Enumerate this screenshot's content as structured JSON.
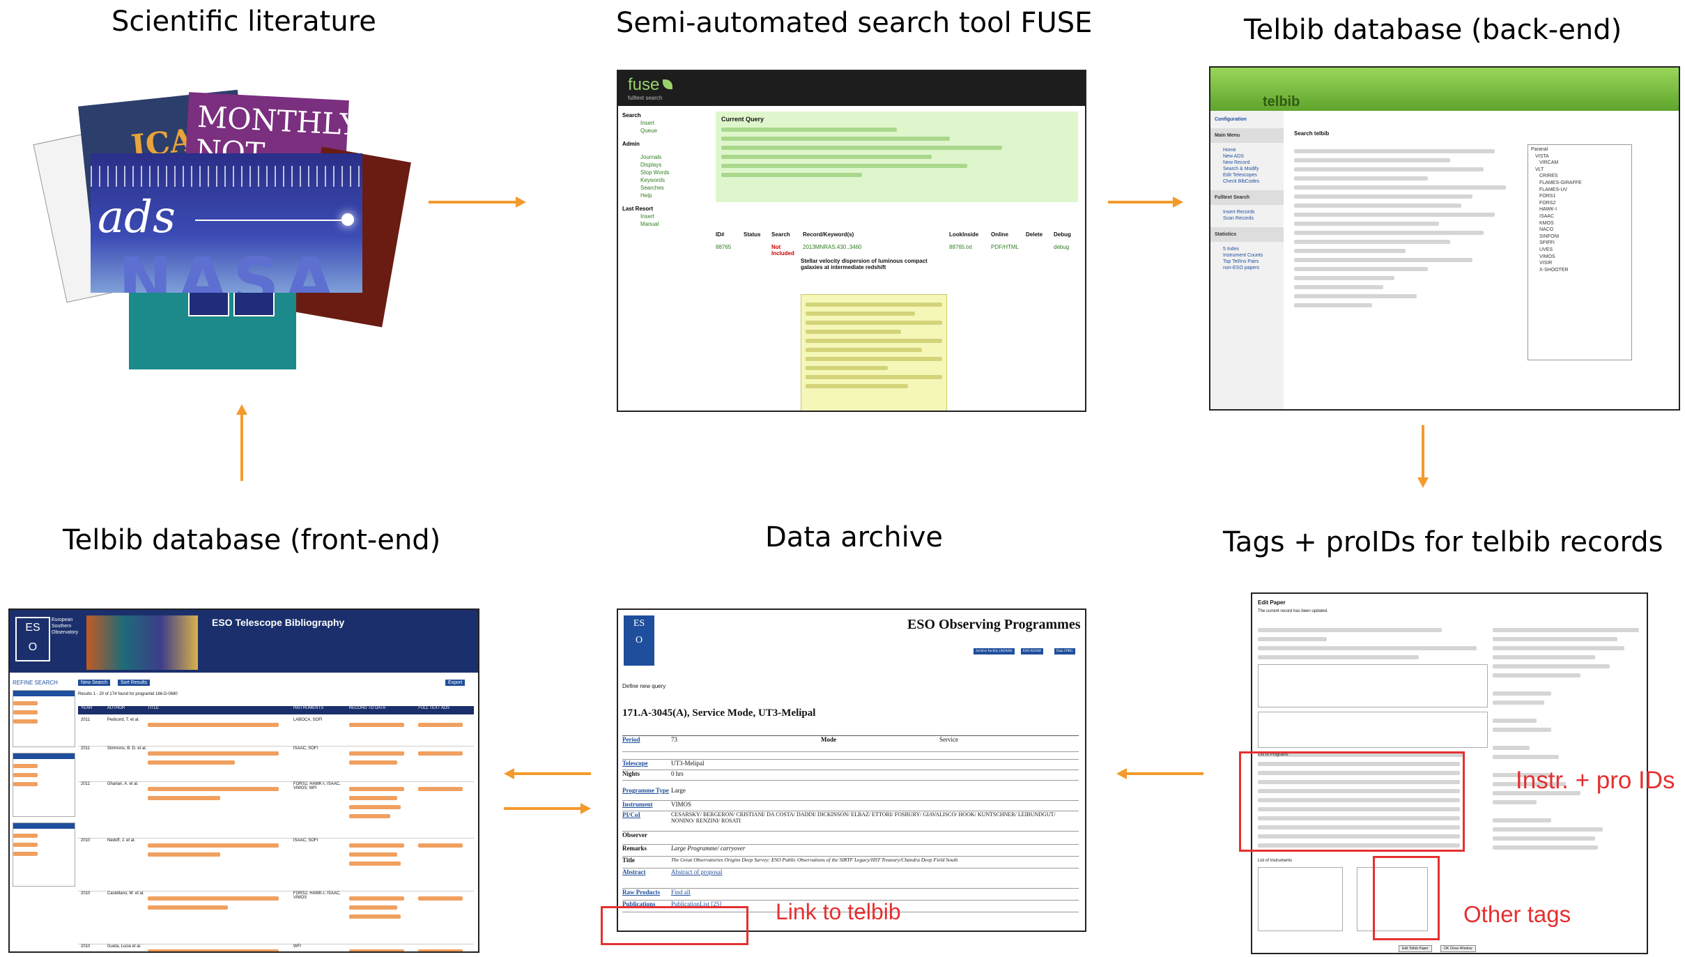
{
  "titles": {
    "literature": "Scientific literature",
    "fuse": "Semi-automated search tool FUSE",
    "backend": "Telbib database (back-end)",
    "frontend": "Telbib database (front-end)",
    "archive": "Data archive",
    "tags": "Tags + proIDs for telbib records"
  },
  "literature": {
    "covers": [
      "ICAR",
      "MONTHLY",
      "NOT",
      "ads",
      "NASA"
    ]
  },
  "fuse": {
    "logo": "fuse",
    "logo_sub": "fulltext search",
    "sidebar": [
      "Search",
      "Insert",
      "Queue",
      "Admin",
      "Journals",
      "Displays",
      "Stop Words",
      "Keywords",
      "Searches",
      "Help",
      "Last Resort",
      "Insert",
      "Manual"
    ],
    "current_query": "Current Query",
    "table_headers": [
      "ID#",
      "Status",
      "Search",
      "Record/Keyword(s)",
      "LookInside",
      "Online",
      "Delete",
      "Debug"
    ],
    "row": [
      "88765",
      "",
      "Not Included",
      "2013MNRAS.430..3460",
      "88765.txt",
      "PDF/HTML",
      "",
      "debug"
    ],
    "record_title": "Stellar velocity dispersion of luminous compact galaxies at intermediate redshift"
  },
  "backend": {
    "logo": "telbib",
    "menu": [
      "Configuration",
      "Main Menu",
      "Home",
      "New ADS",
      "New Record",
      "Search & Modify",
      "Edit Telescopes",
      "Check BibCodes",
      "Fulltext Search",
      "Insert Records",
      "Scan Records",
      "Statistics",
      "5 Index",
      "Instrument Counts",
      "Top Tel/Ins Pairs",
      "non-ESO papers"
    ],
    "heading": "Search telbib",
    "instruments": [
      "Paranal",
      "VISTA",
      "VIRCAM",
      "VLT",
      "CRIRES",
      "FLAMES-GIRAFFE",
      "FLAMES-UV",
      "FORS1",
      "FORS2",
      "HAWK-I",
      "ISAAC",
      "KMOS",
      "NACO",
      "SINFONI",
      "SPIFFI",
      "UVES",
      "VIMOS",
      "VISIR",
      "X-SHOOTER"
    ]
  },
  "frontend": {
    "banner_title": "ESO Telescope Bibliography",
    "eso_text": [
      "European",
      "Southern",
      "Observatory"
    ],
    "refine": "REFINE SEARCH",
    "buttons": [
      "New Search",
      "Sort Results",
      "Export"
    ],
    "results_text": "Results 1 - 20 of 174 found for programid 166-D-0680",
    "columns": [
      "YEAR",
      "AUTHOR",
      "TITLE",
      "INSTRUMENTS",
      "RECORD TO DATA",
      "FULL TEXT ADS"
    ],
    "rows": [
      {
        "year": "2011",
        "author": "Pedicord, T. et al.",
        "inst": "LABOCA, SOFI"
      },
      {
        "year": "2011",
        "author": "Simmons, B. D. et al.",
        "inst": "ISAAC, SOFI"
      },
      {
        "year": "2011",
        "author": "Gharian, A. et al.",
        "inst": "FORS2, HAWK-I, ISAAC, VIMOS, WFI"
      },
      {
        "year": "2010",
        "author": "Nedoff, J. et al.",
        "inst": "ISAAC, SOFI"
      },
      {
        "year": "2010",
        "author": "Castellano, M. et al.",
        "inst": "FORS2, HAWK-I, ISAAC, VIMOS"
      },
      {
        "year": "2010",
        "author": "Gueta, Lucia et al.",
        "inst": "WFI"
      }
    ]
  },
  "archive": {
    "heading": "ESO Observing Programmes",
    "buttons": [
      "Archive Facility (ADAM)",
      "ESO ADAM",
      "Data CPRG"
    ],
    "define": "Define new query",
    "programme": "171.A-3045(A), Service Mode, UT3-Melipal",
    "fields": [
      {
        "label": "Period",
        "value": "73"
      },
      {
        "label": "Telescope",
        "value": "UT3-Melipal"
      },
      {
        "label": "Nights",
        "value": "0 hrs"
      },
      {
        "label": "Programme Type",
        "value": "Large"
      },
      {
        "label": "Instrument",
        "value": "VIMOS"
      },
      {
        "label": "PI/CoI",
        "value": "CESARSKY/ BERGERON/ CRISTIANI/ DA COSTA/ DADDI/ DICKINSON/ ELBAZ/ ETTORI/ FOSBURY/ GIAVALISCO/ HOOK/ KUNTSCHNER/ LEIBUNDGUT/ NONINO/ RENZINI/ ROSATI"
      },
      {
        "label": "Observer",
        "value": ""
      },
      {
        "label": "Remarks",
        "value": "Large Programme/ carryover"
      },
      {
        "label": "Title",
        "value": "The Great Observatories Origins Deep Survey: ESO Public Observations of the SIRTF Legacy/HST Treasury/Chandra Deep Field South"
      },
      {
        "label": "Abstract",
        "value": "Abstract of proposal"
      },
      {
        "label": "Raw Products",
        "value": "Find all"
      },
      {
        "label": "Publications",
        "value": "PublicationList [25]"
      }
    ],
    "mode_label": "Mode",
    "mode_value": "Service"
  },
  "tags": {
    "heading": "Edit Paper",
    "updated": "The current record has been updated.",
    "list_title": "List of Programs",
    "instr_title": "List of Instruments",
    "save_button": "Edit Telbib Paper",
    "close_button": "OK Close Window"
  },
  "annotations": {
    "link_to_telbib": "Link to telbib",
    "instr_pro_ids": "Instr. + pro IDs",
    "other_tags": "Other tags"
  },
  "colors": {
    "arrow": "#f39a2b",
    "annotation": "#e53030",
    "fuse_green": "#dff6cd",
    "telbib_green": "#7cc243",
    "eso_blue": "#1f4e9c"
  }
}
